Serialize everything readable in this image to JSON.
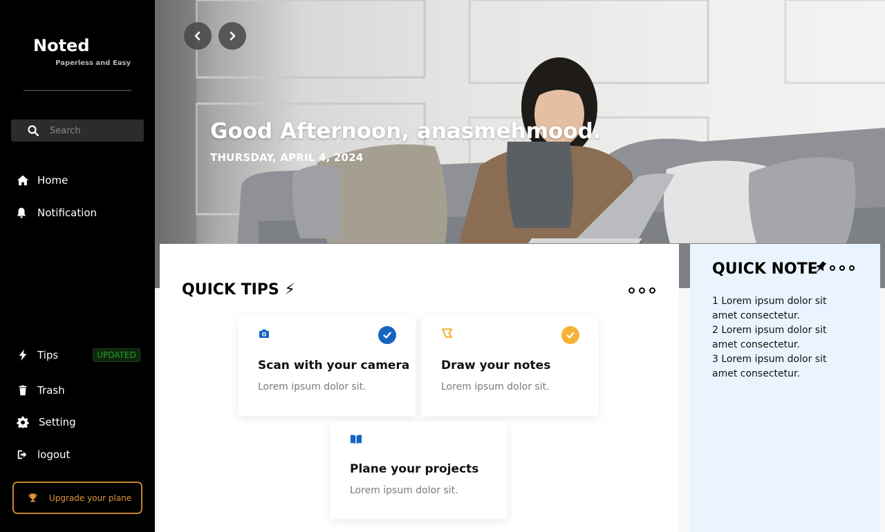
{
  "sidebar": {
    "logo": "Noted",
    "tagline": "Paperless and Easy",
    "search_placeholder": "Search",
    "nav": {
      "home": "Home",
      "notification": "Notification",
      "tips": "Tips",
      "tips_badge": "UPDATED",
      "trash": "Trash",
      "setting": "Setting",
      "logout": "logout"
    },
    "upgrade_label": "Upgrade your plane"
  },
  "hero": {
    "greeting": "Good Afternoon, anasmehmood.",
    "date": "THURSDAY, APRIL 4, 2024"
  },
  "tips": {
    "title": "QUICK TIPS ⚡",
    "cards": [
      {
        "title": "Scan with your camera",
        "desc": "Lorem ipsum dolor sit.",
        "icon": "camera-icon",
        "checked": true,
        "check_color": "#1565c0"
      },
      {
        "title": "Draw your notes",
        "desc": "Lorem ipsum dolor sit.",
        "icon": "draw-icon",
        "checked": true,
        "check_color": "#f5b335"
      },
      {
        "title": "Plane your projects",
        "desc": "Lorem ipsum dolor sit.",
        "icon": "book-icon",
        "checked": false
      }
    ]
  },
  "note": {
    "title": "QUICK NOTE",
    "items": [
      "1   Lorem ipsum dolor sit amet consectetur.",
      "2   Lorem ipsum dolor sit amet consectetur.",
      "3   Lorem ipsum dolor sit amet consectetur."
    ]
  },
  "colors": {
    "sidebar_bg": "#000000",
    "accent_blue": "#1565c0",
    "accent_yellow": "#f5b335",
    "upgrade_orange": "#c8832d",
    "badge_green": "#21a321",
    "note_bg": "#eaf4fe"
  }
}
